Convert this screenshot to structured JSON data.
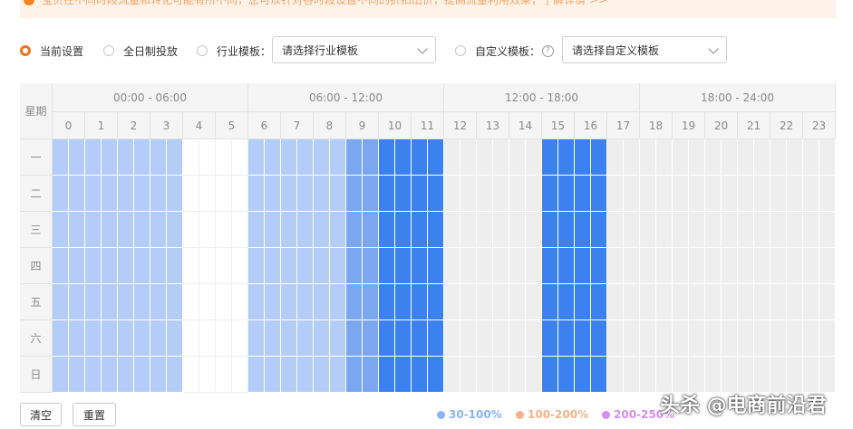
{
  "notice": {
    "text": "宝贝在不同时段流量和转化可能有所不同，您可以针对各时段设置不同的折扣出价，提高流量利用效果，了解详情 >>"
  },
  "options": {
    "current": "当前设置",
    "allday": "全日制投放",
    "industry_label": "行业模板：",
    "industry_placeholder": "请选择行业模板",
    "custom_label": "自定义模板：",
    "custom_placeholder": "请选择自定义模板",
    "help_glyph": "?"
  },
  "grid": {
    "corner_label": "星期",
    "ranges": [
      "00:00 - 06:00",
      "06:00 - 12:00",
      "12:00 - 18:00",
      "18:00 - 24:00"
    ],
    "hours": [
      "0",
      "1",
      "2",
      "3",
      "4",
      "5",
      "6",
      "7",
      "8",
      "9",
      "10",
      "11",
      "12",
      "13",
      "14",
      "15",
      "16",
      "17",
      "18",
      "19",
      "20",
      "21",
      "22",
      "23"
    ],
    "days": [
      "一",
      "二",
      "三",
      "四",
      "五",
      "六",
      "日"
    ],
    "levels_half_hours": [
      1,
      1,
      1,
      1,
      1,
      1,
      1,
      1,
      0,
      0,
      0,
      0,
      1,
      1,
      1,
      1,
      1,
      1,
      2,
      2,
      3,
      3,
      3,
      3,
      4,
      4,
      4,
      4,
      4,
      4,
      3,
      3,
      3,
      3,
      4,
      4,
      4,
      4,
      4,
      4,
      4,
      4,
      4,
      4,
      4,
      4,
      4,
      4
    ],
    "colors": {
      "level1": "#b3cdf8",
      "level2": "#7aa7f0",
      "level3": "#3b82ef",
      "off": "#eeeeee",
      "empty": "#ffffff"
    }
  },
  "buttons": {
    "clear": "清空",
    "reset": "重置"
  },
  "legend": [
    {
      "label": "30-100%",
      "color": "#8cb4f5"
    },
    {
      "label": "100-200%",
      "color": "#f7b28a"
    },
    {
      "label": "200-250%",
      "color": "#d68cf0"
    }
  ],
  "watermark": "头杀 @电商前沿君"
}
